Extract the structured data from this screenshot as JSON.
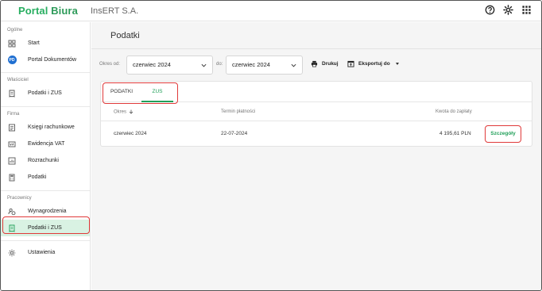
{
  "app": {
    "logo_part1": "Portal",
    "logo_part2": "Biura",
    "company": "InsERT S.A."
  },
  "topbar_icons": [
    "help-icon",
    "gear-icon",
    "apps-grid-icon"
  ],
  "sidebar": {
    "sections": [
      {
        "label": "Ogólne",
        "items": [
          {
            "label": "Start",
            "icon": "dashboard-icon"
          },
          {
            "label": "Portal Dokumentów",
            "icon": "pd-badge-icon",
            "badge": "PD"
          }
        ]
      },
      {
        "label": "Właściciel",
        "items": [
          {
            "label": "Podatki i ZUS",
            "icon": "receipt-icon"
          }
        ]
      },
      {
        "label": "Firma",
        "items": [
          {
            "label": "Księgi rachunkowe",
            "icon": "ledger-icon"
          },
          {
            "label": "Ewidencja VAT",
            "icon": "vat-icon"
          },
          {
            "label": "Rozrachunki",
            "icon": "settlements-icon"
          },
          {
            "label": "Podatki",
            "icon": "calculator-icon"
          }
        ]
      },
      {
        "label": "Pracownicy",
        "items": [
          {
            "label": "Wynagrodzenia",
            "icon": "payroll-icon"
          },
          {
            "label": "Podatki i ZUS",
            "icon": "receipt-icon",
            "active": true
          }
        ]
      }
    ],
    "settings_label": "Ustawienia"
  },
  "main": {
    "title": "Podatki",
    "filters": {
      "from_label": "Okres od:",
      "from_value": "czerwiec 2024",
      "to_label": "do:",
      "to_value": "czerwiec 2024",
      "print_label": "Drukuj",
      "export_label": "Eksportuj do"
    },
    "tabs": [
      {
        "label": "PODATKI",
        "active": false
      },
      {
        "label": "ZUS",
        "active": true
      }
    ],
    "table": {
      "columns": [
        "Okres",
        "Termin płatności",
        "Kwota do zapłaty"
      ],
      "rows": [
        {
          "period": "czerwiec 2024",
          "due": "22-07-2024",
          "amount": "4 195,61 PLN",
          "action": "Szczegóły"
        }
      ]
    }
  },
  "colors": {
    "accent": "#22a05a",
    "active_bg": "#d9f2e3",
    "highlight": "#e03a3a"
  }
}
